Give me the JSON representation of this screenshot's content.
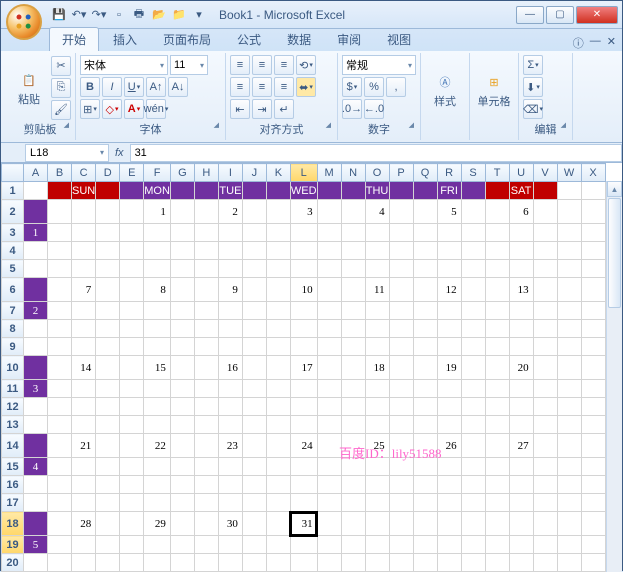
{
  "title": "Book1 - Microsoft Excel",
  "tabs": [
    "开始",
    "插入",
    "页面布局",
    "公式",
    "数据",
    "审阅",
    "视图"
  ],
  "active_tab": 0,
  "ribbon": {
    "clipboard": {
      "label": "剪贴板",
      "paste": "粘贴"
    },
    "font": {
      "label": "字体",
      "name": "宋体",
      "size": "11"
    },
    "align": {
      "label": "对齐方式"
    },
    "number": {
      "label": "数字",
      "format": "常规"
    },
    "style": {
      "label": "样式",
      "btn": "样式"
    },
    "cells": {
      "label": "单元格",
      "btn": "单元格"
    },
    "edit": {
      "label": "编辑"
    }
  },
  "name_box": "L18",
  "formula": "31",
  "columns": [
    "A",
    "B",
    "C",
    "D",
    "E",
    "F",
    "G",
    "H",
    "I",
    "J",
    "K",
    "L",
    "M",
    "N",
    "O",
    "P",
    "Q",
    "R",
    "S",
    "T",
    "U",
    "V",
    "W",
    "X"
  ],
  "col_widths": {
    "A": 16
  },
  "active_cell": {
    "row": 18,
    "col": "L"
  },
  "sel_rows": [
    18,
    19
  ],
  "day_headers": [
    {
      "col": "C",
      "text": "SUN",
      "cls": "dayhdr-sun"
    },
    {
      "col": "F",
      "text": "MON",
      "cls": "dayhdr"
    },
    {
      "col": "I",
      "text": "TUE",
      "cls": "dayhdr"
    },
    {
      "col": "L",
      "text": "WED",
      "cls": "dayhdr"
    },
    {
      "col": "O",
      "text": "THU",
      "cls": "dayhdr"
    },
    {
      "col": "R",
      "text": "FRI",
      "cls": "dayhdr"
    },
    {
      "col": "U",
      "text": "SAT",
      "cls": "dayhdr-sat"
    }
  ],
  "week_nums": [
    {
      "row": 3,
      "text": "1"
    },
    {
      "row": 7,
      "text": "2"
    },
    {
      "row": 11,
      "text": "3"
    },
    {
      "row": 15,
      "text": "4"
    },
    {
      "row": 19,
      "text": "5"
    }
  ],
  "values": {
    "2": {
      "F": "1",
      "I": "2",
      "L": "3",
      "O": "4",
      "R": "5",
      "U": "6"
    },
    "6": {
      "C": "7",
      "F": "8",
      "I": "9",
      "L": "10",
      "O": "11",
      "R": "12",
      "U": "13"
    },
    "10": {
      "C": "14",
      "F": "15",
      "I": "16",
      "L": "17",
      "O": "18",
      "R": "19",
      "U": "20"
    },
    "14": {
      "C": "21",
      "F": "22",
      "I": "23",
      "L": "24",
      "O": "25",
      "R": "26",
      "U": "27"
    },
    "18": {
      "C": "28",
      "F": "29",
      "I": "30",
      "L": "31"
    }
  },
  "watermark": "百度ID：lily51588"
}
